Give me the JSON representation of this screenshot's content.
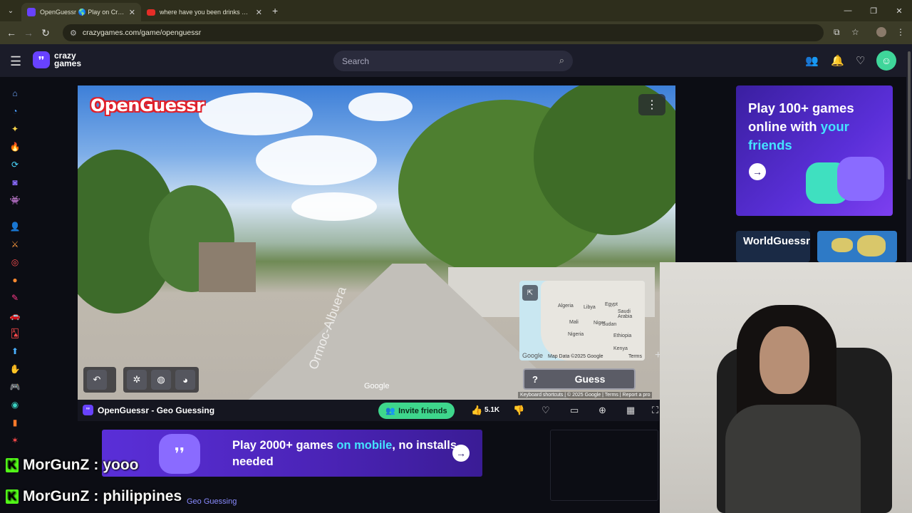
{
  "browser": {
    "tabs": [
      {
        "title": "OpenGuessr 🌎 Play on CrazyGames",
        "active": true
      },
      {
        "title": "where have you been drinks on me",
        "active": false
      }
    ],
    "new_tab_label": "+",
    "url": "crazygames.com/game/openguessr",
    "window_controls": [
      "—",
      "❐",
      "✕"
    ]
  },
  "site": {
    "logo_line1": "crazy",
    "logo_line2": "games",
    "search_placeholder": "Search"
  },
  "game": {
    "title_overlay": "OpenGuessr",
    "guess_label": "Guess",
    "help_label": "?",
    "google_watermark": "Google",
    "road_label": "Ormoc-Albuera",
    "map_labels": [
      "Algeria",
      "Libya",
      "Egypt",
      "Saudi Arabia",
      "Niger",
      "Sudan",
      "Nigeria",
      "Ethiopia",
      "Kenya",
      "Mali"
    ],
    "map_credit": "Map Data ©2025 Google",
    "map_terms": "Terms",
    "map_google": "Google",
    "footer_credit": "Keyboard shortcuts | © 2025 Google | Terms | Report a pro"
  },
  "game_bar": {
    "title": "OpenGuessr - Geo Guessing",
    "invite_label": "Invite friends",
    "likes": "5.1K"
  },
  "promos": {
    "side_line1": "Play 100+ games",
    "side_line2": "online with ",
    "side_hl": "your friends",
    "worldguessr": "WorldGuessr",
    "bottom_pre": "Play 2000+ games ",
    "bottom_hl": "on mobile",
    "bottom_post": ", no installs needed"
  },
  "chat": [
    {
      "user": "MorGunZ",
      "msg": "yooo"
    },
    {
      "user": "MorGunZ",
      "msg": "philippines"
    }
  ],
  "breadcrumb": "Geo Guessing",
  "colors": {
    "brand": "#6842ff",
    "invite": "#3ed68c",
    "kick": "#53fc18",
    "highlight": "#45e3ff"
  }
}
